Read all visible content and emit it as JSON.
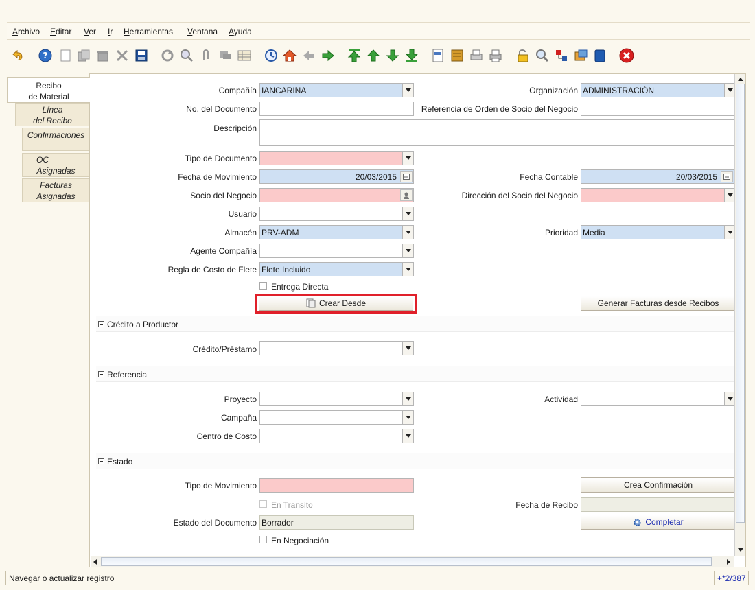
{
  "menu": [
    "Archivo",
    "Editar",
    "Ver",
    "Ir",
    "Herramientas",
    "Ventana",
    "Ayuda"
  ],
  "toolbar_icons": [
    "undo-icon",
    "help-icon",
    "new-record-icon",
    "copy-record-icon",
    "delete-icon",
    "delete-selection-icon",
    "save-icon",
    "refresh-icon",
    "find-icon",
    "attachment-icon",
    "chat-icon",
    "grid-toggle-icon",
    "history-icon",
    "home-icon",
    "previous-tab-icon",
    "next-tab-icon",
    "first-record-icon",
    "previous-record-icon",
    "next-record-icon",
    "last-record-icon",
    "report-icon",
    "archive-icon",
    "print-preview-icon",
    "print-icon",
    "lock-icon",
    "zoom-across-icon",
    "request-icon",
    "product-info-icon",
    "workflow-icon",
    "close-window-icon"
  ],
  "tabs": [
    {
      "line1": "Recibo",
      "line2": "de Material"
    },
    {
      "line1": "Línea",
      "line2": "del Recibo"
    },
    {
      "line1": "Confirmaciones",
      "line2": ""
    },
    {
      "line1": "OC",
      "line2": "Asignadas"
    },
    {
      "line1": "Facturas",
      "line2": "Asignadas"
    }
  ],
  "form": {
    "company_label": "Compañía",
    "company_value": "IANCARINA",
    "org_label": "Organización",
    "org_value": "ADMINISTRACIÓN",
    "docno_label": "No. del Documento",
    "docno_value": "",
    "bporder_ref_label": "Referencia de Orden de Socio del Negocio",
    "bporder_ref_value": "",
    "description_label": "Descripción",
    "description_value": "",
    "doctype_label": "Tipo de Documento",
    "doctype_value": "",
    "movdate_label": "Fecha de Movimiento",
    "movdate_value": "20/03/2015",
    "acctdate_label": "Fecha Contable",
    "acctdate_value": "20/03/2015",
    "bpartner_label": "Socio del Negocio",
    "bpartner_value": "",
    "bplocation_label": "Dirección del Socio del Negocio",
    "bplocation_value": "",
    "user_label": "Usuario",
    "user_value": "",
    "warehouse_label": "Almacén",
    "warehouse_value": "PRV-ADM",
    "priority_label": "Prioridad",
    "priority_value": "Media",
    "salesrep_label": "Agente Compañía",
    "salesrep_value": "",
    "freight_label": "Regla de Costo de Flete",
    "freight_value": "Flete Incluido",
    "dropship_label": "Entrega Directa",
    "create_from_label": "Crear Desde",
    "gen_invoices_label": "Generar Facturas desde Recibos"
  },
  "sections": {
    "credit": {
      "title": "Crédito a Productor",
      "loan_label": "Crédito/Préstamo",
      "loan_value": ""
    },
    "reference": {
      "title": "Referencia",
      "project_label": "Proyecto",
      "project_value": "",
      "activity_label": "Actividad",
      "activity_value": "",
      "campaign_label": "Campaña",
      "campaign_value": "",
      "costcenter_label": "Centro de Costo",
      "costcenter_value": ""
    },
    "status": {
      "title": "Estado",
      "movtype_label": "Tipo de Movimiento",
      "movtype_value": "",
      "create_confirm_label": "Crea Confirmación",
      "intransit_label": "En Transito",
      "receiptdate_label": "Fecha de Recibo",
      "receiptdate_value": "",
      "docstatus_label": "Estado del Documento",
      "docstatus_value": "Borrador",
      "complete_label": "Completar",
      "negotiation_label": "En Negociación"
    }
  },
  "statusbar": {
    "message": "Navegar o actualizar registro",
    "record_info": "+*2/387"
  },
  "colors": {
    "mandatory": "#fbcaca",
    "readonly": "#cfe0f3",
    "highlight": "#e0202a"
  }
}
